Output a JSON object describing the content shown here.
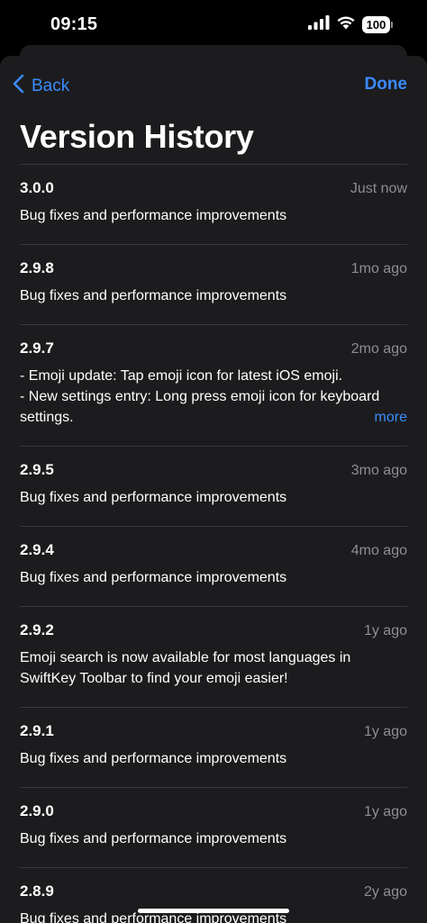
{
  "status_bar": {
    "time": "09:15",
    "battery": "100"
  },
  "nav": {
    "back_label": "Back",
    "done_label": "Done"
  },
  "title": "Version History",
  "entries": [
    {
      "version": "3.0.0",
      "date": "Just now",
      "notes": "Bug fixes and performance improvements"
    },
    {
      "version": "2.9.8",
      "date": "1mo ago",
      "notes": "Bug fixes and performance improvements"
    },
    {
      "version": "2.9.7",
      "date": "2mo ago",
      "notes": "- Emoji update: Tap emoji icon for latest iOS emoji.\n- New settings entry: Long press emoji icon for keyboard settings.",
      "more": "more"
    },
    {
      "version": "2.9.5",
      "date": "3mo ago",
      "notes": "Bug fixes and performance improvements"
    },
    {
      "version": "2.9.4",
      "date": "4mo ago",
      "notes": "Bug fixes and performance improvements"
    },
    {
      "version": "2.9.2",
      "date": "1y ago",
      "notes": "Emoji search is now available for most languages in SwiftKey Toolbar to find your emoji easier!"
    },
    {
      "version": "2.9.1",
      "date": "1y ago",
      "notes": "Bug fixes and performance improvements"
    },
    {
      "version": "2.9.0",
      "date": "1y ago",
      "notes": "Bug fixes and performance improvements"
    },
    {
      "version": "2.8.9",
      "date": "2y ago",
      "notes": "Bug fixes and performance improvements"
    }
  ],
  "colors": {
    "accent": "#3a8bff",
    "sheet_background": "#1c1c1e",
    "secondary_text": "#8e8e93"
  },
  "icons": [
    "cellular-signal-icon",
    "wifi-icon",
    "battery-icon",
    "chevron-left-icon"
  ]
}
